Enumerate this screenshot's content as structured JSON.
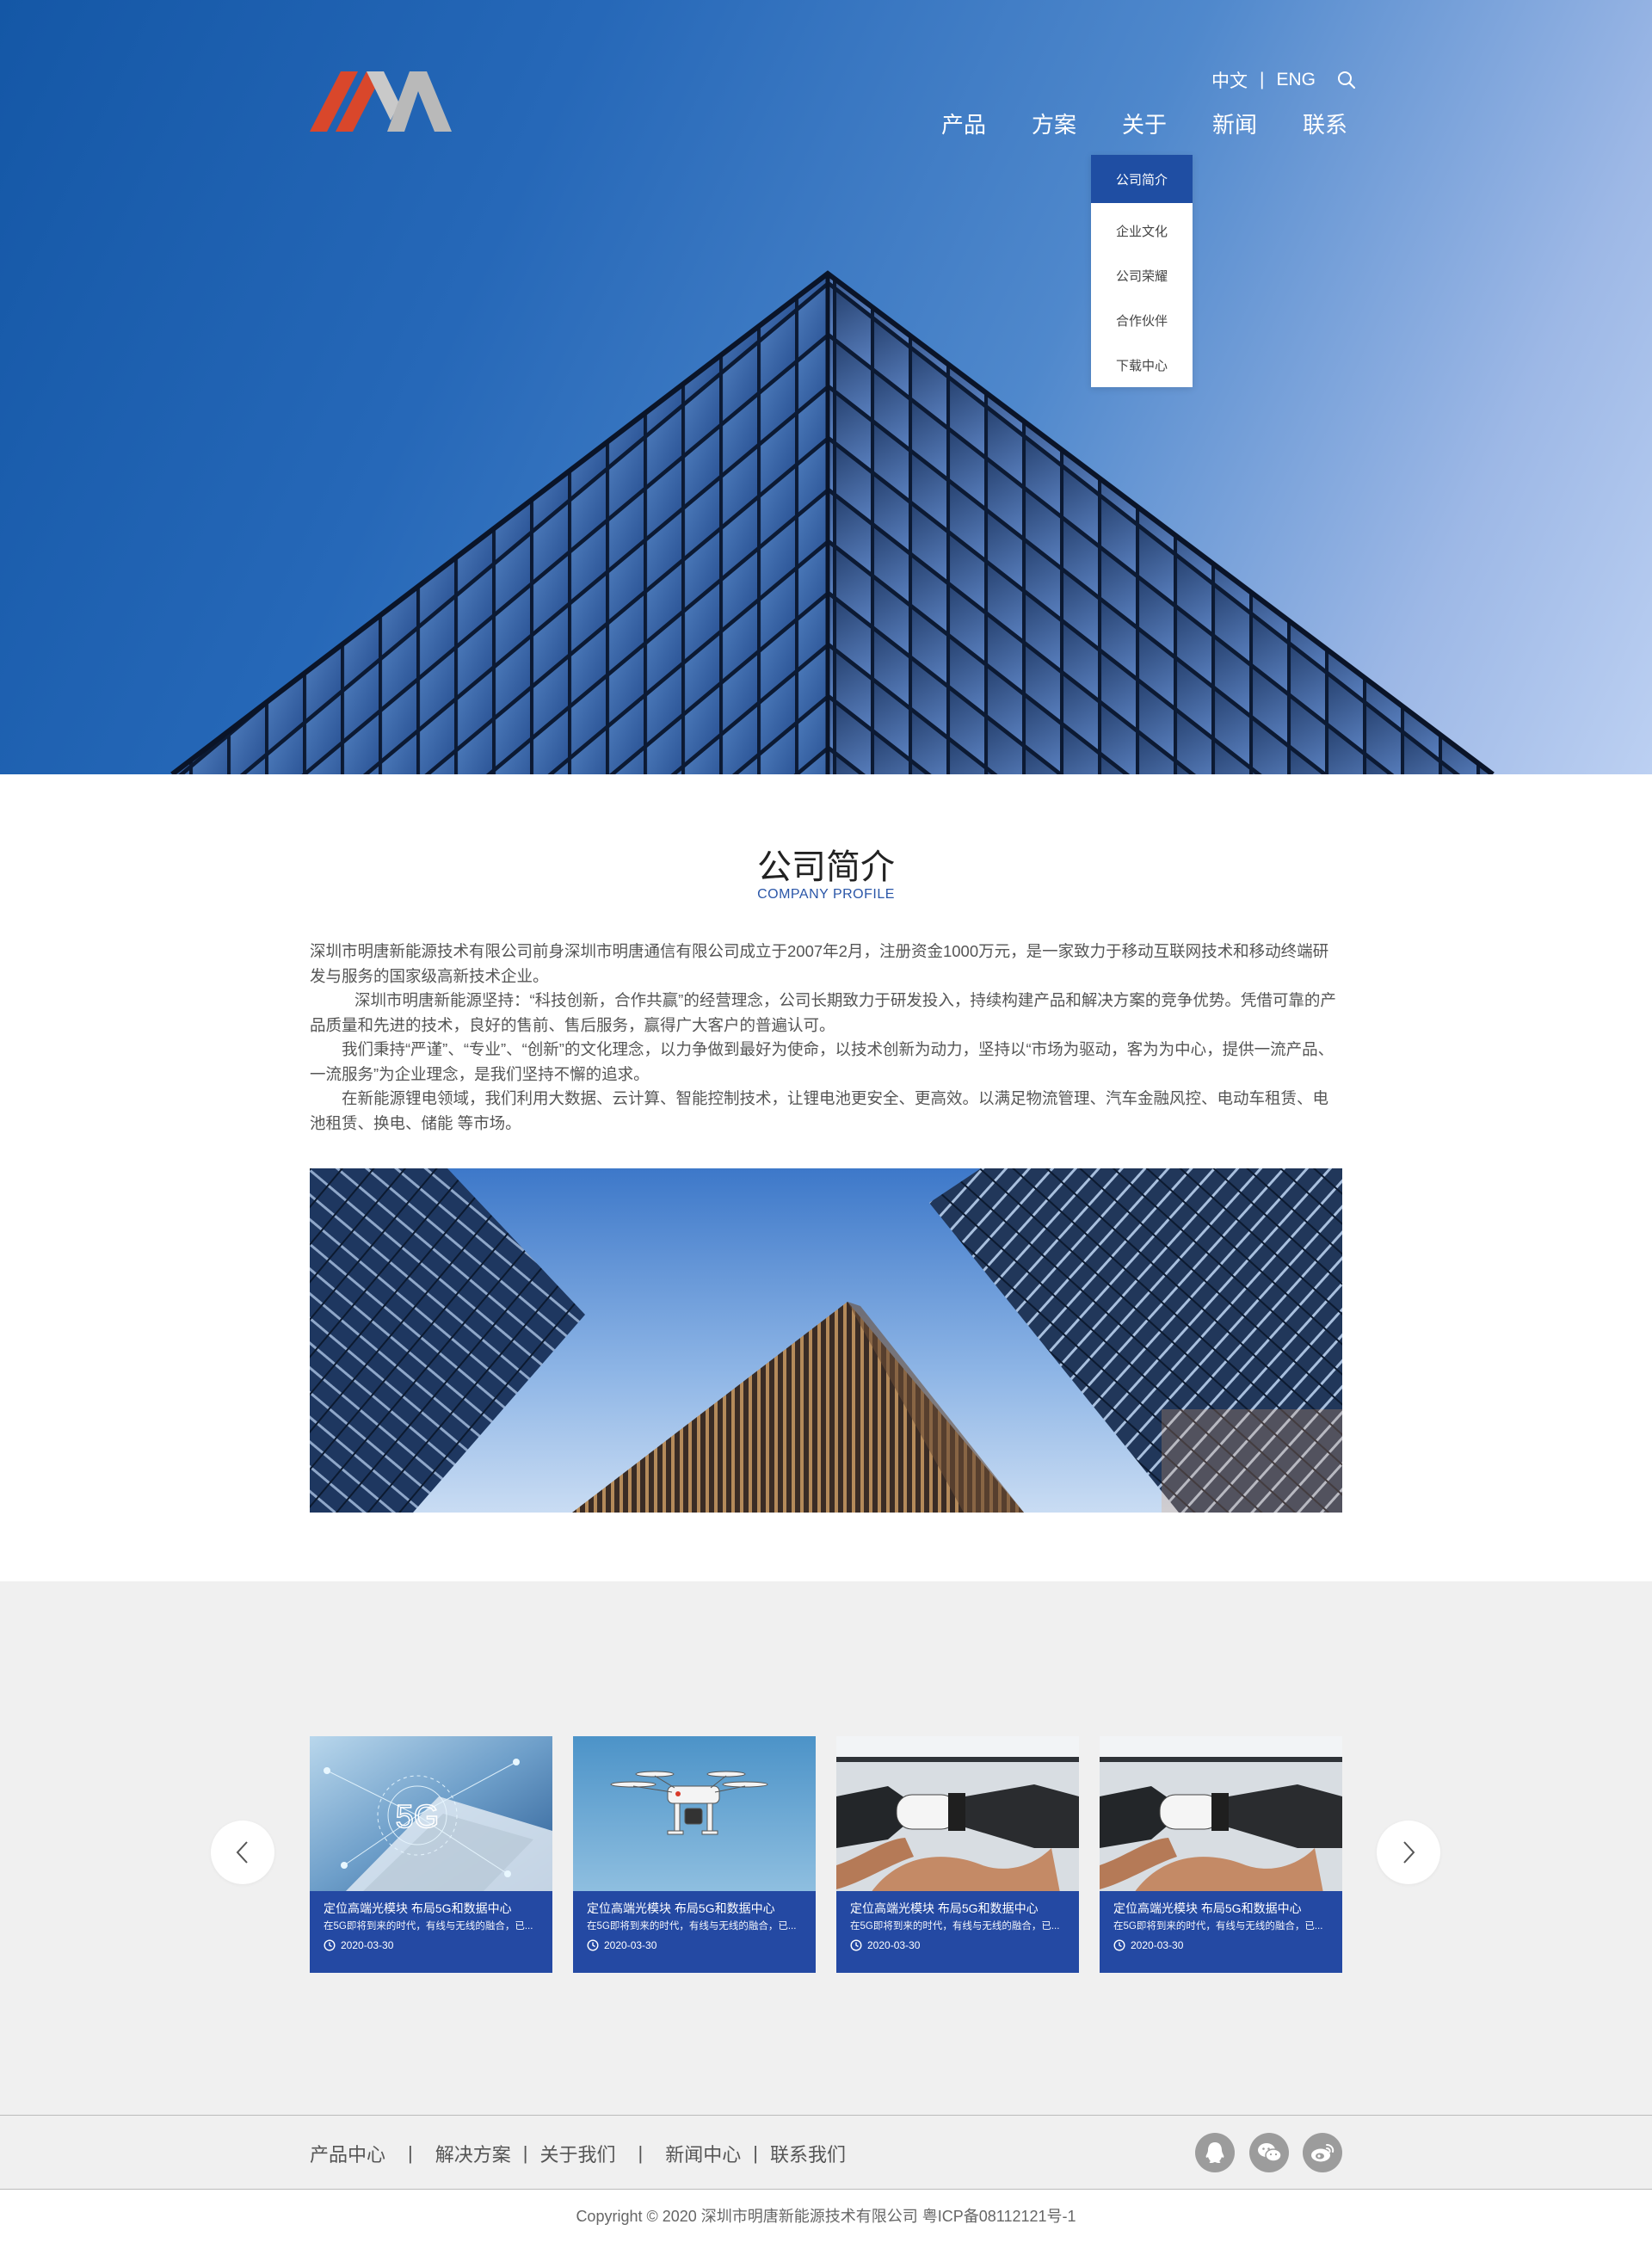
{
  "header": {
    "lang_cn": "中文",
    "lang_sep": "|",
    "lang_en": "ENG",
    "nav": [
      "产品",
      "方案",
      "关于",
      "新闻",
      "联系"
    ],
    "dropdown": [
      "公司简介",
      "企业文化",
      "公司荣耀",
      "合作伙伴",
      "下载中心"
    ]
  },
  "about": {
    "title": "公司简介",
    "subtitle": "COMPANY PROFILE",
    "paragraphs": [
      "深圳市明唐新能源技术有限公司前身深圳市明唐通信有限公司成立于2007年2月，注册资金1000万元，是一家致力于移动互联网技术和移动终端研发与服务的国家级高新技术企业。",
      "深圳市明唐新能源坚持：“科技创新，合作共赢”的经营理念，公司长期致力于研发投入，持续构建产品和解决方案的竞争优势。凭借可靠的产品质量和先进的技术，良好的售前、售后服务，赢得广大客户的普遍认可。",
      "我们秉持“严谨”、“专业”、“创新”的文化理念，以力争做到最好为使命，以技术创新为动力，坚持以“市场为驱动，客为为中心，提供一流产品、一流服务”为企业理念，是我们坚持不懈的追求。",
      "在新能源锂电领域，我们利用大数据、云计算、智能控制技术，让锂电池更安全、更高效。以满足物流管理、汽车金融风控、电动车租赁、电池租赁、换电、储能 等市场。"
    ]
  },
  "news": {
    "cards": [
      {
        "title": "定位高端光模块 布局5G和数据中心",
        "desc": "在5G即将到来的时代，有线与无线的融合，已...",
        "date": "2020-03-30"
      },
      {
        "title": "定位高端光模块 布局5G和数据中心",
        "desc": "在5G即将到来的时代，有线与无线的融合，已...",
        "date": "2020-03-30"
      },
      {
        "title": "定位高端光模块 布局5G和数据中心",
        "desc": "在5G即将到来的时代，有线与无线的融合，已...",
        "date": "2020-03-30"
      },
      {
        "title": "定位高端光模块 布局5G和数据中心",
        "desc": "在5G即将到来的时代，有线与无线的融合，已...",
        "date": "2020-03-30"
      }
    ],
    "badge_5g": "5G"
  },
  "footer": {
    "links": [
      "产品中心",
      "解决方案",
      "关于我们",
      "新闻中心",
      "联系我们"
    ],
    "sep": "|",
    "copyright": "Copyright © 2020  深圳市明唐新能源技术有限公司   粤ICP备08112121号-1"
  },
  "colors": {
    "brand_blue": "#2449a3",
    "logo_red": "#d9472b",
    "logo_gray": "#b9b9b9"
  }
}
